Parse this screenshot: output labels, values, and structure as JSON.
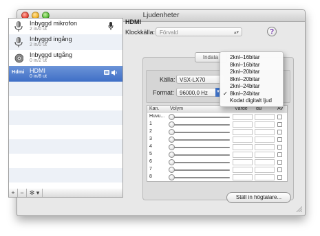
{
  "window": {
    "title": "Ljudenheter"
  },
  "devices": [
    {
      "name": "Inbyggd mikrofon",
      "channels": "2 in/0 ut",
      "icon": "microphone-icon"
    },
    {
      "name": "Inbyggd ingång",
      "channels": "2 in/0 ut",
      "icon": "line-in-icon"
    },
    {
      "name": "Inbyggd utgång",
      "channels": "0 in/2 ut",
      "icon": "speaker-icon"
    },
    {
      "name": "HDMI",
      "channels": "0 in/8 ut",
      "icon": "hdmi-icon",
      "logo_text": "Hdmi",
      "selected": true
    }
  ],
  "list_toolbar": {
    "add": "+",
    "remove": "−",
    "gear": "✻ ▾"
  },
  "detail": {
    "device_title": "HDMI",
    "clock_label": "Klockkälla:",
    "clock_value": "Förvald",
    "help": "?",
    "tab_input": "Indata",
    "source_label": "Källa:",
    "source_value": "VSX-LX70",
    "format_label": "Format:",
    "format_value": "96000,0 Hz"
  },
  "table": {
    "headers": {
      "channel": "Kan.",
      "volume": "Volym",
      "value": "Värde",
      "db": "dB",
      "mute": "Av"
    },
    "rows": [
      "Huvu...",
      "1",
      "2",
      "3",
      "4",
      "5",
      "6",
      "7",
      "8"
    ]
  },
  "speaker_button": "Ställ in högtalare...",
  "format_menu": {
    "items": [
      {
        "label": "2knl–16bitar",
        "checked": false
      },
      {
        "label": "8knl–16bitar",
        "checked": false
      },
      {
        "label": "2knl–20bitar",
        "checked": false
      },
      {
        "label": "8knl–20bitar",
        "checked": false
      },
      {
        "label": "2knl–24bitar",
        "checked": false
      },
      {
        "label": "8knl–24bitar",
        "checked": true
      },
      {
        "label": "Kodat digitalt ljud",
        "checked": false
      }
    ],
    "check_glyph": "✓"
  },
  "colors": {
    "selection": "#3f6fc6",
    "accent": "#3f72c7"
  }
}
